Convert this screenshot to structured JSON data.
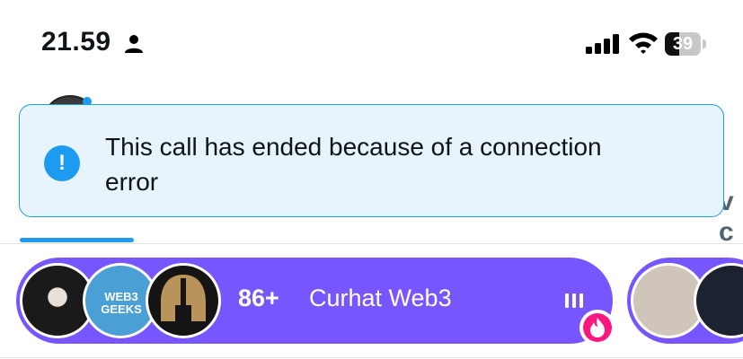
{
  "status_bar": {
    "time": "21.59",
    "battery_percent": "39",
    "battery_level": 0.39
  },
  "toast": {
    "message": "This call has ended because of a connection error",
    "icon": "!"
  },
  "spaces": {
    "live_space": {
      "listener_count": "86+",
      "title": "Curhat Web3",
      "web3_logo_text": "WEB3 GEEKS"
    }
  },
  "colors": {
    "accent_blue": "#1d9bf0",
    "spaces_purple": "#7856ff",
    "toast_bg": "#e8f4fc",
    "fire_pink": "#f91880"
  },
  "icons": [
    "person-icon",
    "signal-icon",
    "wifi-icon",
    "battery-icon",
    "alert-icon",
    "pause-icon",
    "fire-icon"
  ]
}
